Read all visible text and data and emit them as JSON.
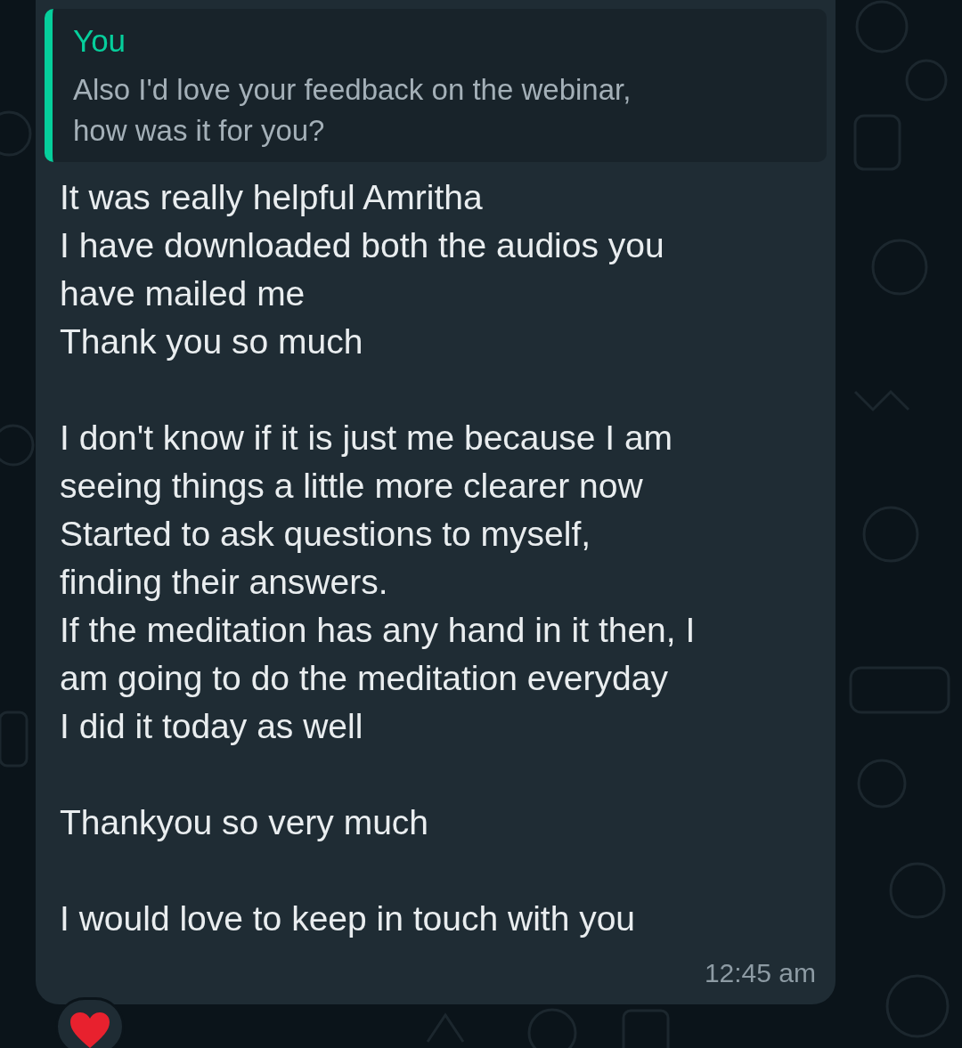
{
  "message": {
    "quote": {
      "author": "You",
      "text": "Also I'd love your feedback on the webinar,\nhow was it for you?"
    },
    "paragraphs": [
      [
        "It was really helpful Amritha",
        "I have downloaded both the audios you",
        "have mailed me",
        "Thank you so much"
      ],
      [
        "I don't know if it is just me because I am",
        "seeing things a little more clearer now",
        "Started to ask questions to myself,",
        "finding their answers.",
        "If the meditation has any hand in it then, I",
        "am going to do the meditation everyday",
        "I did it today as well"
      ],
      [
        "Thankyou so very much"
      ],
      [
        "I would love to keep in touch with you"
      ]
    ],
    "time": "12:45 am"
  }
}
